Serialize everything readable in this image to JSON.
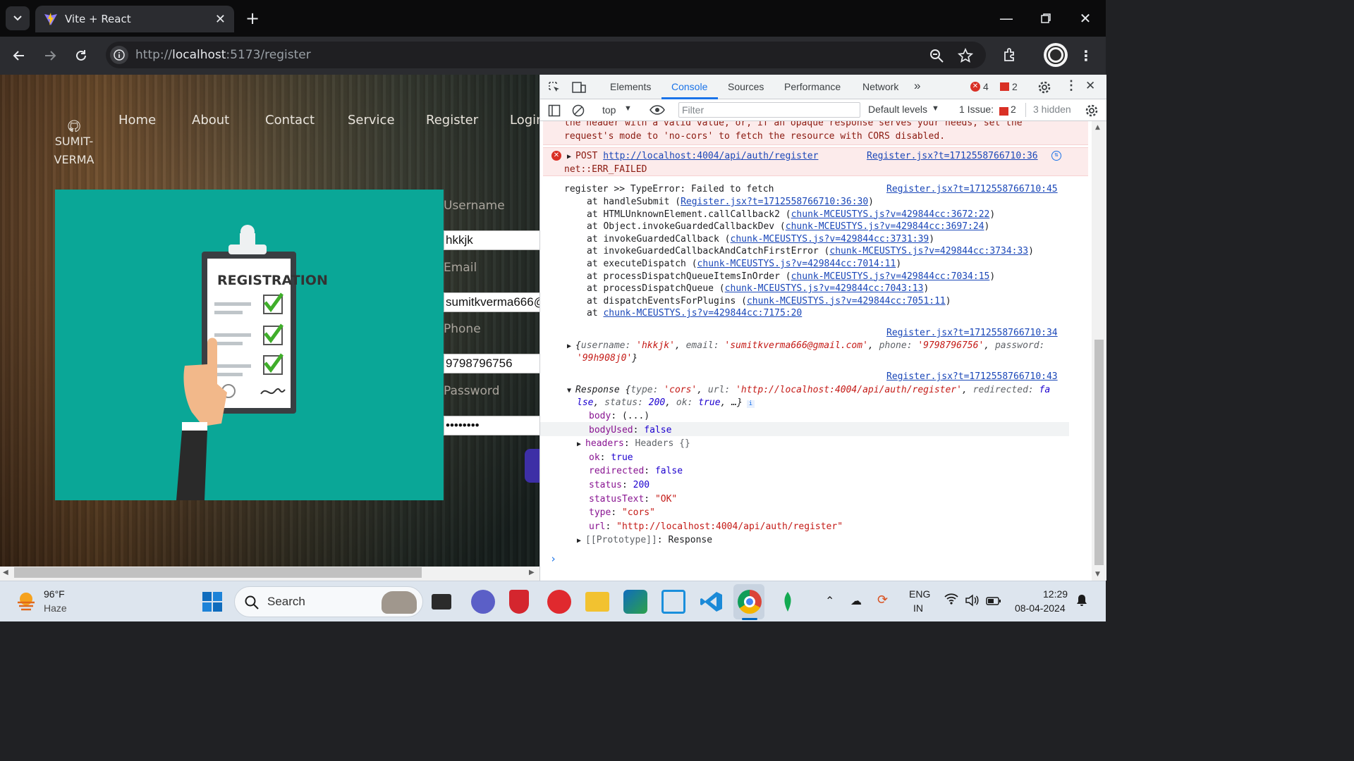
{
  "browser": {
    "tab_title": "Vite + React",
    "url_prefix": "http://",
    "url_host": "localhost",
    "url_rest": ":5173/register"
  },
  "site": {
    "logo_line1": "SUMIT-",
    "logo_line2": "VERMA",
    "nav": [
      "Home",
      "About",
      "Contact",
      "Service",
      "Register",
      "Login"
    ],
    "hero_text": "REGISTRATION",
    "form": {
      "username_label": "Username",
      "username_value": "hkkjk",
      "email_label": "Email",
      "email_value": "sumitkverma666@",
      "phone_label": "Phone",
      "phone_value": "9798796756",
      "password_label": "Password",
      "password_value": "••••••••"
    }
  },
  "devtools": {
    "tabs": [
      "Elements",
      "Console",
      "Sources",
      "Performance",
      "Network"
    ],
    "active_tab": "Console",
    "error_count": "4",
    "issue_count": "2",
    "context": "top",
    "filter_placeholder": "Filter",
    "levels": "Default levels",
    "issues_label": "1 Issue:",
    "issues_badge": "2",
    "hidden": "3 hidden"
  },
  "console": {
    "cors_line1": "the header with a valid value, or, if an opaque response serves your needs, set the",
    "cors_line2": "request's mode to 'no-cors' to fetch the resource with CORS disabled.",
    "post_method": "POST",
    "post_url": "http://localhost:4004/api/auth/register",
    "post_src": "Register.jsx?t=1712558766710:36",
    "post_err": "net::ERR_FAILED",
    "reg_msg": "register >> TypeError: Failed to fetch",
    "reg_src": "Register.jsx?t=1712558766710:45",
    "stack": [
      {
        "fn": "at handleSubmit (",
        "loc": "Register.jsx?t=1712558766710:36:30",
        "end": ")"
      },
      {
        "fn": "at HTMLUnknownElement.callCallback2 (",
        "loc": "chunk-MCEUSTYS.js?v=429844cc:3672:22",
        "end": ")"
      },
      {
        "fn": "at Object.invokeGuardedCallbackDev (",
        "loc": "chunk-MCEUSTYS.js?v=429844cc:3697:24",
        "end": ")"
      },
      {
        "fn": "at invokeGuardedCallback (",
        "loc": "chunk-MCEUSTYS.js?v=429844cc:3731:39",
        "end": ")"
      },
      {
        "fn": "at invokeGuardedCallbackAndCatchFirstError (",
        "loc": "chunk-MCEUSTYS.js?v=429844cc:3734:33",
        "end": ")"
      },
      {
        "fn": "at executeDispatch (",
        "loc": "chunk-MCEUSTYS.js?v=429844cc:7014:11",
        "end": ")"
      },
      {
        "fn": "at processDispatchQueueItemsInOrder (",
        "loc": "chunk-MCEUSTYS.js?v=429844cc:7034:15",
        "end": ")"
      },
      {
        "fn": "at processDispatchQueue (",
        "loc": "chunk-MCEUSTYS.js?v=429844cc:7043:13",
        "end": ")"
      },
      {
        "fn": "at dispatchEventsForPlugins (",
        "loc": "chunk-MCEUSTYS.js?v=429844cc:7051:11",
        "end": ")"
      },
      {
        "fn": "at ",
        "loc": "chunk-MCEUSTYS.js?v=429844cc:7175:20",
        "end": ""
      }
    ],
    "obj_src": "Register.jsx?t=1712558766710:34",
    "obj": {
      "username": "'hkkjk'",
      "email": "'sumitkverma666@gmail.com'",
      "phone": "'9798796756'",
      "password": "'99h908j0'"
    },
    "resp_src": "Register.jsx?t=1712558766710:43",
    "resp_type": "'cors'",
    "resp_url": "'http://localhost:4004/api/auth/register'",
    "resp_redirected": "false",
    "resp_status": "200",
    "resp_ok": "true",
    "props": [
      {
        "k": "body",
        "v": "(...)",
        "cls": "kl"
      },
      {
        "k": "bodyUsed",
        "v": "false",
        "cls": "num"
      },
      {
        "k": "headers",
        "v": "Headers {}",
        "cls": "gray"
      },
      {
        "k": "ok",
        "v": "true",
        "cls": "num"
      },
      {
        "k": "redirected",
        "v": "false",
        "cls": "num"
      },
      {
        "k": "status",
        "v": "200",
        "cls": "num"
      },
      {
        "k": "statusText",
        "v": "\"OK\"",
        "cls": "str"
      },
      {
        "k": "type",
        "v": "\"cors\"",
        "cls": "str"
      },
      {
        "k": "url",
        "v": "\"http://localhost:4004/api/auth/register\"",
        "cls": "str"
      },
      {
        "k": "[[Prototype]]",
        "v": "Response",
        "cls": "kl"
      }
    ]
  },
  "taskbar": {
    "weather_temp": "96°F",
    "weather_desc": "Haze",
    "search_label": "Search",
    "lang1": "ENG",
    "lang2": "IN",
    "time": "12:29",
    "date": "08-04-2024"
  }
}
